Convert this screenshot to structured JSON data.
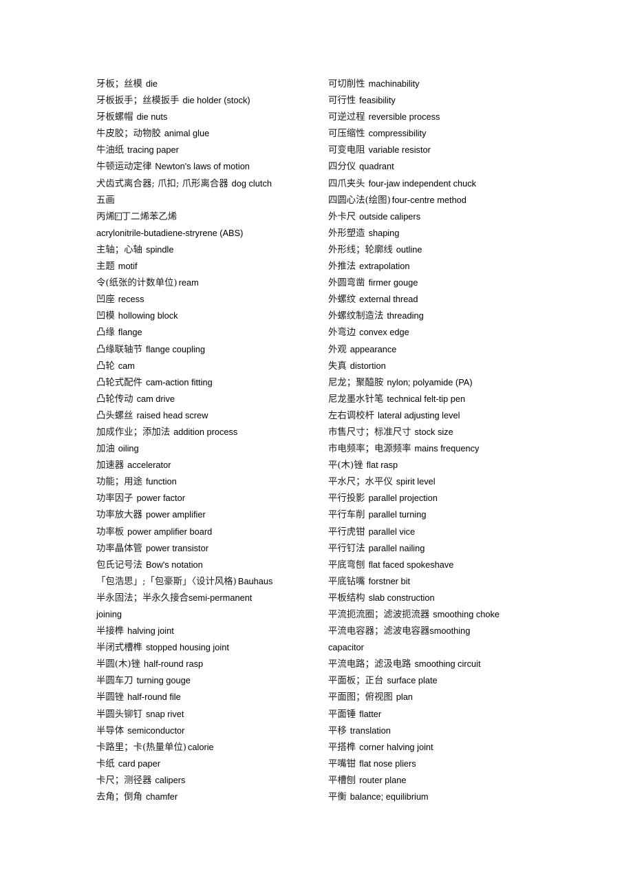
{
  "page": {
    "kind": "glossary-page",
    "background_color": "#ffffff",
    "columns": 2
  },
  "left_column": {
    "entries": [
      {
        "zh": "牙板；丝模",
        "en": "die"
      },
      {
        "zh": "牙板扳手；丝模扳手",
        "en": "die holder (stock)"
      },
      {
        "zh": "牙板螺帽",
        "en": "die nuts"
      },
      {
        "zh": "牛皮胶；动物胶",
        "en": "animal glue"
      },
      {
        "zh": "牛油纸",
        "en": "tracing paper"
      },
      {
        "zh": "牛顿运动定律",
        "en": "Newton's laws of motion"
      },
      {
        "zh": "犬齿式离合器; 爪扣; 爪形离合器",
        "en": "dog clutch"
      },
      {
        "zh": "五画",
        "en": "",
        "type": "section"
      },
      {
        "zh": "丙烯腈丁二烯苯乙烯",
        "en": "",
        "type": "justified",
        "chars": [
          "丙",
          "烯",
          "?",
          "丁",
          "二",
          "烯",
          "苯",
          "乙",
          "烯"
        ],
        "missing_glyph_index": 2
      },
      {
        "zh": "",
        "en": "acrylonitrile-butadiene-stryrene (ABS)",
        "type": "continuation"
      },
      {
        "zh": "主轴；心轴",
        "en": "spindle"
      },
      {
        "zh": "主题",
        "en": "motif"
      },
      {
        "zh": "令(纸张的计数单位)",
        "en": "ream",
        "tight": true
      },
      {
        "zh": "凹座",
        "en": "recess"
      },
      {
        "zh": "凹模",
        "en": "hollowing block"
      },
      {
        "zh": "凸缘",
        "en": "flange"
      },
      {
        "zh": "凸缘联轴节",
        "en": "flange coupling"
      },
      {
        "zh": "凸轮",
        "en": "cam"
      },
      {
        "zh": "凸轮式配件",
        "en": "cam-action fitting"
      },
      {
        "zh": "凸轮传动",
        "en": "cam drive"
      },
      {
        "zh": "凸头螺丝",
        "en": "raised head screw"
      },
      {
        "zh": "加成作业；添加法",
        "en": "addition process"
      },
      {
        "zh": "加油",
        "en": "oiling"
      },
      {
        "zh": "加速器",
        "en": "accelerator"
      },
      {
        "zh": "功能；用途",
        "en": "function"
      },
      {
        "zh": "功率因子",
        "en": "power factor"
      },
      {
        "zh": "功率放大器",
        "en": "power amplifier"
      },
      {
        "zh": "功率板",
        "en": "power amplifier board"
      },
      {
        "zh": "功率晶体管",
        "en": "power transistor"
      },
      {
        "zh": "包氏记号法",
        "en": "Bow's notation"
      },
      {
        "zh": "「包浩思」;「包豪斯」〈设计风格)",
        "en": "Bauhaus",
        "tight": true
      },
      {
        "zh": "半永固法；半永久接合",
        "en": "semi-permanent",
        "type": "justified-mixed",
        "chars": [
          "半",
          "永",
          "固",
          "法",
          "；",
          "半",
          "永",
          "久",
          "接",
          "合"
        ]
      },
      {
        "zh": "",
        "en": "joining",
        "type": "continuation"
      },
      {
        "zh": "半接榫",
        "en": "halving joint"
      },
      {
        "zh": "半闭式槽榫",
        "en": "stopped housing joint"
      },
      {
        "zh": "半圆(木)锉",
        "en": "half-round rasp"
      },
      {
        "zh": "半圆车刀",
        "en": "turning gouge"
      },
      {
        "zh": "半圆锉",
        "en": "half-round file"
      },
      {
        "zh": "半圆头铆钉",
        "en": "snap rivet"
      },
      {
        "zh": "半导体",
        "en": "semiconductor"
      },
      {
        "zh": "卡路里；卡(热量单位)",
        "en": "calorie",
        "tight": true
      },
      {
        "zh": "卡纸",
        "en": "card paper"
      },
      {
        "zh": "卡尺；测径器",
        "en": "calipers"
      },
      {
        "zh": "去角；倒角",
        "en": "chamfer"
      }
    ]
  },
  "right_column": {
    "entries": [
      {
        "zh": "可切削性",
        "en": "machinability"
      },
      {
        "zh": "可行性",
        "en": "feasibility"
      },
      {
        "zh": "可逆过程",
        "en": "reversible process"
      },
      {
        "zh": "可压缩性",
        "en": "compressibility"
      },
      {
        "zh": "可变电阻",
        "en": "variable resistor"
      },
      {
        "zh": "四分仪",
        "en": "quadrant"
      },
      {
        "zh": "四爪夹头",
        "en": "four-jaw independent chuck"
      },
      {
        "zh": "四圆心法(绘图)",
        "en": "four-centre method",
        "tight": true
      },
      {
        "zh": "外卡尺",
        "en": "outside calipers"
      },
      {
        "zh": "外形塑造",
        "en": "shaping"
      },
      {
        "zh": "外形线；轮廓线",
        "en": "outline"
      },
      {
        "zh": "外推法",
        "en": "extrapolation"
      },
      {
        "zh": "外圆弯凿",
        "en": "firmer gouge"
      },
      {
        "zh": "外螺纹",
        "en": "external thread"
      },
      {
        "zh": "外螺纹制造法",
        "en": "threading"
      },
      {
        "zh": "外弯边",
        "en": "convex edge"
      },
      {
        "zh": "外观",
        "en": "appearance"
      },
      {
        "zh": "失真",
        "en": "distortion"
      },
      {
        "zh": "尼龙；聚醯胺",
        "en": "nylon; polyamide (PA)"
      },
      {
        "zh": "尼龙墨水针笔",
        "en": "technical felt-tip pen"
      },
      {
        "zh": "左右调校杆",
        "en": "lateral adjusting level"
      },
      {
        "zh": "市售尺寸；标准尺寸",
        "en": "stock size"
      },
      {
        "zh": "市电频率；电源频率",
        "en": "mains frequency"
      },
      {
        "zh": "平(木)锉",
        "en": "flat rasp"
      },
      {
        "zh": "平水尺；水平仪",
        "en": "spirit level"
      },
      {
        "zh": "平行投影",
        "en": "parallel projection"
      },
      {
        "zh": "平行车削",
        "en": "parallel turning"
      },
      {
        "zh": "平行虎钳",
        "en": "parallel vice"
      },
      {
        "zh": "平行钉法",
        "en": "parallel nailing"
      },
      {
        "zh": "平底弯刨",
        "en": "flat faced spokeshave"
      },
      {
        "zh": "平底钻嘴",
        "en": "forstner bit"
      },
      {
        "zh": "平板结构",
        "en": "slab construction"
      },
      {
        "zh": "平流扼流圈；滤波扼流器",
        "en": "smoothing choke"
      },
      {
        "zh": "平流电容器；滤波电容器",
        "en": "smoothing",
        "type": "justified-mixed",
        "chars": [
          "平",
          "流",
          "电",
          "容",
          "器",
          "；",
          "滤",
          "波",
          "电",
          "容",
          "器"
        ]
      },
      {
        "zh": "",
        "en": "capacitor",
        "type": "continuation"
      },
      {
        "zh": "平流电路；滤汲电路",
        "en": "smoothing circuit"
      },
      {
        "zh": "平面板；正台",
        "en": "surface plate"
      },
      {
        "zh": "平面图；俯视图",
        "en": "plan"
      },
      {
        "zh": "平面锤",
        "en": "flatter"
      },
      {
        "zh": "平移",
        "en": "translation"
      },
      {
        "zh": "平搭榫",
        "en": "corner halving joint"
      },
      {
        "zh": "平嘴钳",
        "en": "flat nose pliers"
      },
      {
        "zh": "平槽刨",
        "en": "router plane"
      },
      {
        "zh": "平衡",
        "en": "balance; equilibrium"
      }
    ]
  }
}
